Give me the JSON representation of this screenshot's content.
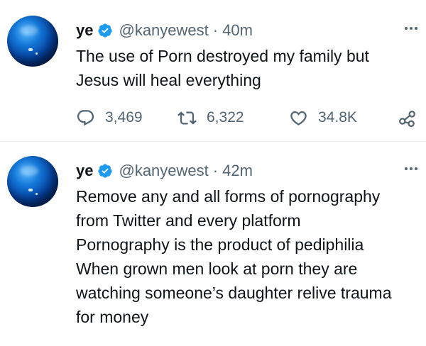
{
  "tweets": [
    {
      "name": "ye",
      "handle": "@kanyewest",
      "separator": "·",
      "time": "40m",
      "text": "The use of Porn destroyed my family but\nJesus will heal everything",
      "replies": "3,469",
      "retweets": "6,322",
      "likes": "34.8K"
    },
    {
      "name": "ye",
      "handle": "@kanyewest",
      "separator": "·",
      "time": "42m",
      "text": "Remove any and all forms of pornography\nfrom Twitter and every platform\nPornography is the product of pediphilia\nWhen grown men look at porn they are\nwatching someone’s daughter relive trauma\nfor money"
    }
  ],
  "colors": {
    "verified": "#1d9bf0",
    "secondary_text": "#536471",
    "primary_text": "#0f1419",
    "divider": "#e6ecf0"
  },
  "icons": {
    "verified": "verified-badge-icon",
    "more": "more-options-icon",
    "reply": "reply-icon",
    "retweet": "retweet-icon",
    "like": "heart-icon",
    "share": "share-icon"
  }
}
